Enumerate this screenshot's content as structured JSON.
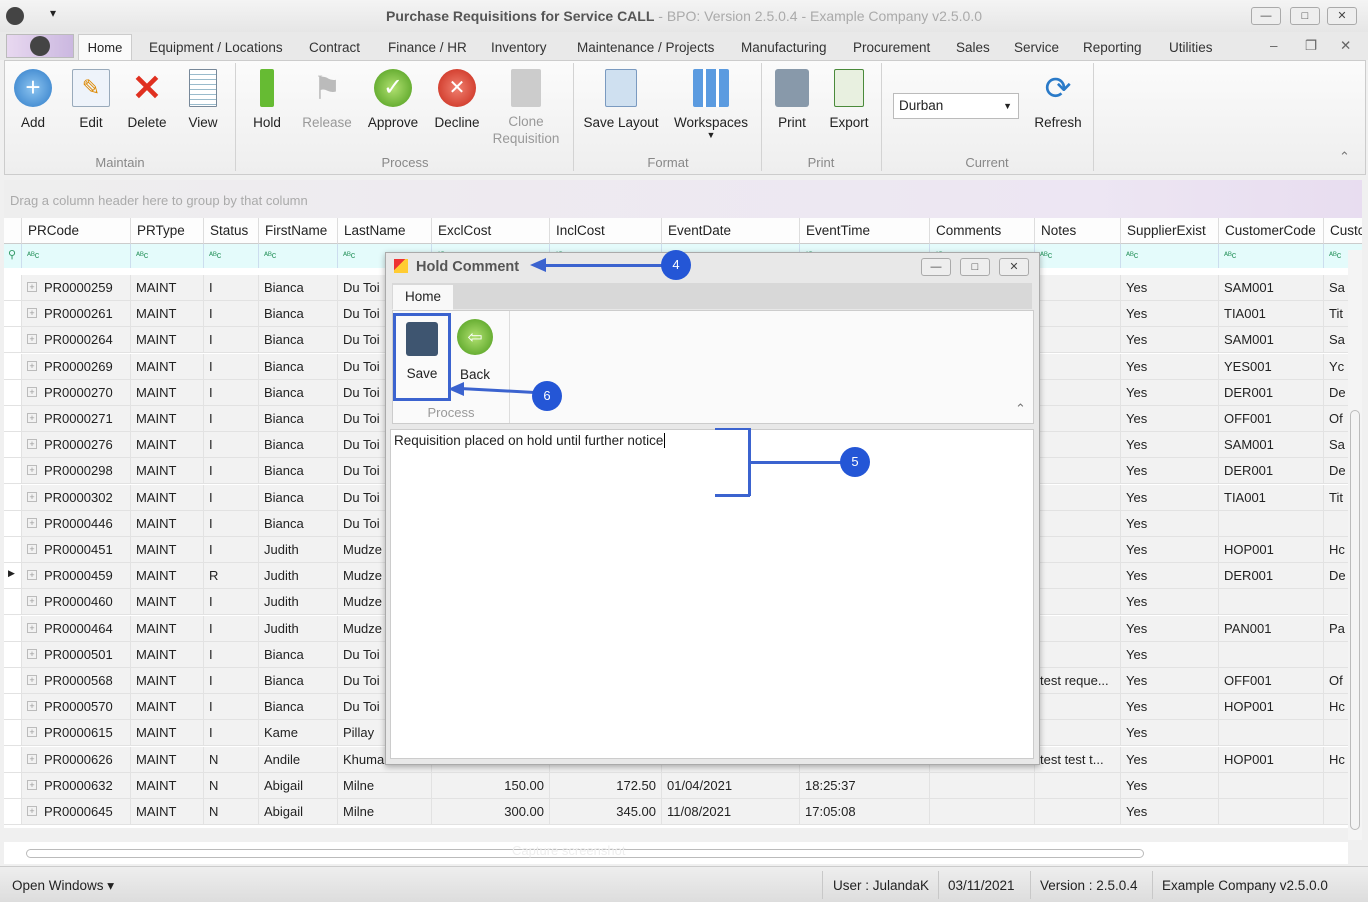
{
  "window": {
    "title": "Purchase Requisitions for Service CALL",
    "subtitle": " - BPO: Version 2.5.0.4 - Example Company v2.5.0.0"
  },
  "menu_tabs": [
    "Home",
    "Equipment / Locations",
    "Contract",
    "Finance / HR",
    "Inventory",
    "Maintenance / Projects",
    "Manufacturing",
    "Procurement",
    "Sales",
    "Service",
    "Reporting",
    "Utilities"
  ],
  "ribbon": {
    "maintain": {
      "label": "Maintain",
      "buttons": [
        "Add",
        "Edit",
        "Delete",
        "View"
      ]
    },
    "process": {
      "label": "Process",
      "buttons": [
        "Hold",
        "Release",
        "Approve",
        "Decline",
        "Clone Requisition"
      ]
    },
    "format": {
      "label": "Format",
      "buttons": [
        "Save Layout",
        "Workspaces"
      ]
    },
    "print": {
      "label": "Print",
      "buttons": [
        "Print",
        "Export"
      ]
    },
    "current": {
      "label": "Current",
      "site": "Durban",
      "refresh": "Refresh"
    }
  },
  "grid": {
    "group_hint": "Drag a column header here to group by that column",
    "columns": [
      "PRCode",
      "PRType",
      "Status",
      "FirstName",
      "LastName",
      "ExclCost",
      "InclCost",
      "EventDate",
      "EventTime",
      "Comments",
      "Notes",
      "SupplierExist",
      "CustomerCode",
      "Custo"
    ],
    "rows": [
      [
        "PR0000259",
        "MAINT",
        "I",
        "Bianca",
        "Du Toi",
        "",
        "",
        "",
        "",
        "",
        "",
        "Yes",
        "SAM001",
        "Sa"
      ],
      [
        "PR0000261",
        "MAINT",
        "I",
        "Bianca",
        "Du Toi",
        "",
        "",
        "",
        "",
        "",
        "",
        "Yes",
        "TIA001",
        "Tit"
      ],
      [
        "PR0000264",
        "MAINT",
        "I",
        "Bianca",
        "Du Toi",
        "",
        "",
        "",
        "",
        "",
        "",
        "Yes",
        "SAM001",
        "Sa"
      ],
      [
        "PR0000269",
        "MAINT",
        "I",
        "Bianca",
        "Du Toi",
        "",
        "",
        "",
        "",
        "",
        "",
        "Yes",
        "YES001",
        "Yc"
      ],
      [
        "PR0000270",
        "MAINT",
        "I",
        "Bianca",
        "Du Toi",
        "",
        "",
        "",
        "",
        "",
        "",
        "Yes",
        "DER001",
        "De"
      ],
      [
        "PR0000271",
        "MAINT",
        "I",
        "Bianca",
        "Du Toi",
        "",
        "",
        "",
        "",
        "",
        "",
        "Yes",
        "OFF001",
        "Of"
      ],
      [
        "PR0000276",
        "MAINT",
        "I",
        "Bianca",
        "Du Toi",
        "",
        "",
        "",
        "",
        "",
        "",
        "Yes",
        "SAM001",
        "Sa"
      ],
      [
        "PR0000298",
        "MAINT",
        "I",
        "Bianca",
        "Du Toi",
        "",
        "",
        "",
        "",
        "",
        "",
        "Yes",
        "DER001",
        "De"
      ],
      [
        "PR0000302",
        "MAINT",
        "I",
        "Bianca",
        "Du Toi",
        "",
        "",
        "",
        "",
        "",
        "",
        "Yes",
        "TIA001",
        "Tit"
      ],
      [
        "PR0000446",
        "MAINT",
        "I",
        "Bianca",
        "Du Toi",
        "",
        "",
        "",
        "",
        "",
        "",
        "Yes",
        "",
        ""
      ],
      [
        "PR0000451",
        "MAINT",
        "I",
        "Judith",
        "Mudze",
        "",
        "",
        "",
        "",
        "",
        "",
        "Yes",
        "HOP001",
        "Hc"
      ],
      [
        "PR0000459",
        "MAINT",
        "R",
        "Judith",
        "Mudze",
        "",
        "",
        "",
        "",
        "",
        "",
        "Yes",
        "DER001",
        "De"
      ],
      [
        "PR0000460",
        "MAINT",
        "I",
        "Judith",
        "Mudze",
        "",
        "",
        "",
        "",
        "",
        "",
        "Yes",
        "",
        ""
      ],
      [
        "PR0000464",
        "MAINT",
        "I",
        "Judith",
        "Mudze",
        "",
        "",
        "",
        "",
        "",
        "",
        "Yes",
        "PAN001",
        "Pa"
      ],
      [
        "PR0000501",
        "MAINT",
        "I",
        "Bianca",
        "Du Toi",
        "",
        "",
        "",
        "",
        "",
        "",
        "Yes",
        "",
        ""
      ],
      [
        "PR0000568",
        "MAINT",
        "I",
        "Bianca",
        "Du Toi",
        "",
        "",
        "",
        "",
        "",
        "test reque...",
        "Yes",
        "OFF001",
        "Of"
      ],
      [
        "PR0000570",
        "MAINT",
        "I",
        "Bianca",
        "Du Toi",
        "",
        "",
        "",
        "",
        "",
        "",
        "Yes",
        "HOP001",
        "Hc"
      ],
      [
        "PR0000615",
        "MAINT",
        "I",
        "Kame",
        "Pillay",
        "",
        "",
        "",
        "",
        "",
        "",
        "Yes",
        "",
        ""
      ],
      [
        "PR0000626",
        "MAINT",
        "N",
        "Andile",
        "Khuma",
        "",
        "",
        "",
        "",
        "",
        "test test t...",
        "Yes",
        "HOP001",
        "Hc"
      ],
      [
        "PR0000632",
        "MAINT",
        "N",
        "Abigail",
        "Milne",
        "150.00",
        "172.50",
        "01/04/2021",
        "18:25:37",
        "",
        "",
        "Yes",
        "",
        ""
      ],
      [
        "PR0000645",
        "MAINT",
        "N",
        "Abigail",
        "Milne",
        "300.00",
        "345.00",
        "11/08/2021",
        "17:05:08",
        "",
        "",
        "Yes",
        "",
        ""
      ]
    ],
    "current_row": 11
  },
  "dialog": {
    "title": "Hold Comment",
    "tab": "Home",
    "save": "Save",
    "back": "Back",
    "group": "Process",
    "comment": "Requisition placed on hold until further notice"
  },
  "annotations": [
    "4",
    "5",
    "6"
  ],
  "watermark": "Capture screenshot",
  "status": {
    "open_windows": "Open Windows ▾",
    "user": "User : JulandaK",
    "date": "03/11/2021",
    "version": "Version : 2.5.0.4",
    "company": "Example Company v2.5.0.0"
  }
}
